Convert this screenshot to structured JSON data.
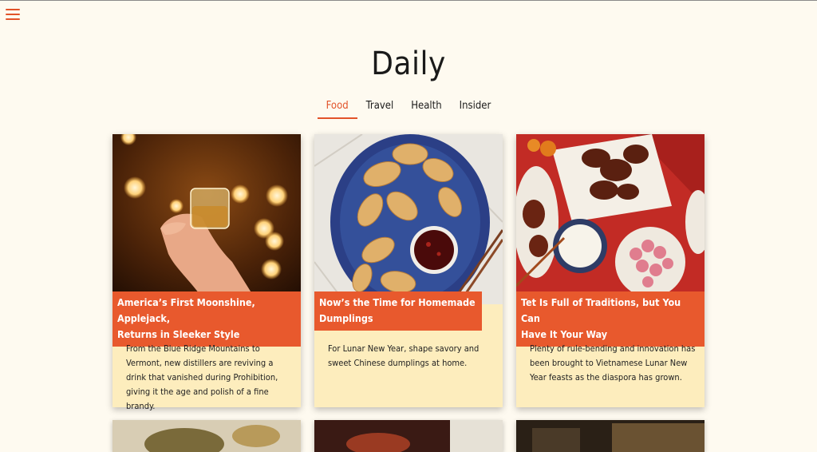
{
  "app": {
    "title": "Daily",
    "menu_icon": "hamburger-icon",
    "accent_color": "#e2532a"
  },
  "tabs": [
    {
      "label": "Food",
      "active": true
    },
    {
      "label": "Travel",
      "active": false
    },
    {
      "label": "Health",
      "active": false
    },
    {
      "label": "Insider",
      "active": false
    }
  ],
  "cards": [
    {
      "image": "moonshine-glass-photo",
      "headline": "America's First Moonshine, Applejack, Returns in Sleeker Style",
      "headline_line1": "America’s First Moonshine, Applejack,",
      "headline_line2": "Returns in Sleeker Style",
      "description": "From the Blue Ridge Mountains to Vermont, new distillers are reviving a drink that vanished during Prohibition, giving it the age and polish of a fine brandy."
    },
    {
      "image": "dumplings-plate-photo",
      "headline_line1": "Now’s the Time for Homemade",
      "headline_line2": "Dumplings",
      "description": "For Lunar New Year, shape savory and sweet Chinese dumplings at home."
    },
    {
      "image": "tet-feast-photo",
      "headline_line1": "Tet Is Full of Traditions, but You Can",
      "headline_line2": "Have It Your Way",
      "description": "Plenty of rule-bending and innovation has been brought to Vietnamese Lunar New Year feasts as the diaspora has grown."
    }
  ],
  "more_cards": [
    {
      "image": "food-bowl-photo"
    },
    {
      "image": "grilled-dish-photo"
    },
    {
      "image": "restaurant-interior-photo"
    }
  ]
}
